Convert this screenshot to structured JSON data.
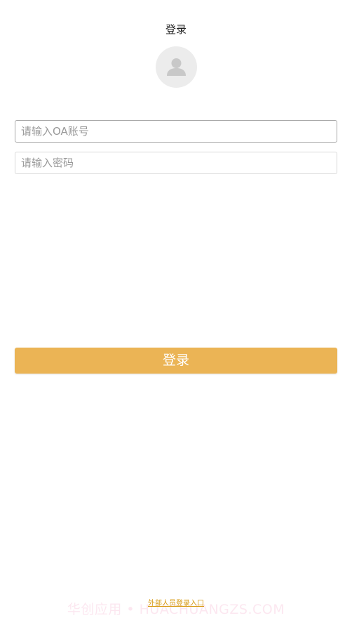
{
  "header": {
    "title": "登录"
  },
  "avatar": {
    "icon": "user-avatar-icon"
  },
  "form": {
    "account_placeholder": "请输入OA账号",
    "account_value": "",
    "password_placeholder": "请输入密码",
    "password_value": "",
    "submit_label": "登录"
  },
  "footer": {
    "external_login_label": "外部人员登录入口",
    "watermark_text": "华创应用 • HUACHUANGZS.COM"
  },
  "colors": {
    "accent": "#ebb455",
    "link": "#d79a12"
  }
}
